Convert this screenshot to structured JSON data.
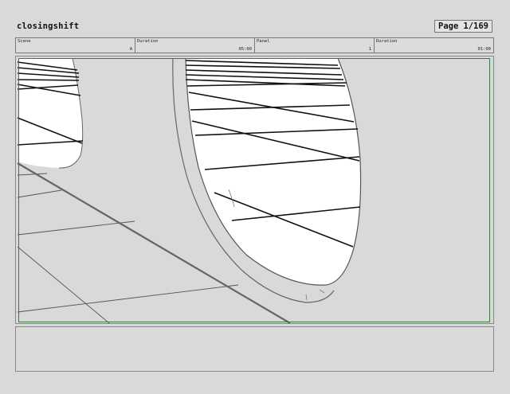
{
  "header": {
    "title": "closingshift",
    "page_label": "Page",
    "page_value": "1/169"
  },
  "info": [
    {
      "label": "Scene",
      "value": "A"
    },
    {
      "label": "Duration",
      "value": "05:00"
    },
    {
      "label": "Panel",
      "value": "1"
    },
    {
      "label": "Duration",
      "value": "01:00"
    }
  ],
  "colors": {
    "background": "#d9d9d9",
    "safe_frame": "#3a7a3a",
    "ink": "#111111"
  }
}
